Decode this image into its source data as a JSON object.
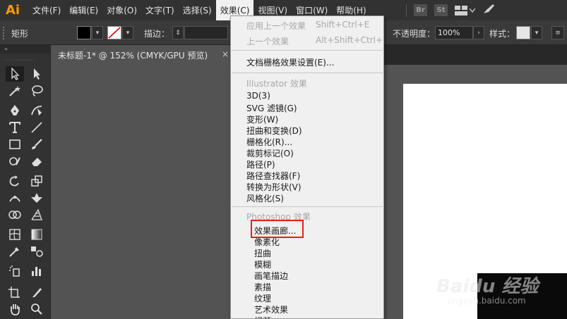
{
  "app": {
    "logo": "Ai"
  },
  "menubar": {
    "items": [
      "文件(F)",
      "编辑(E)",
      "对象(O)",
      "文字(T)",
      "选择(S)",
      "效果(C)",
      "视图(V)",
      "窗口(W)",
      "帮助(H)"
    ],
    "right_icons": [
      "Br",
      "St"
    ]
  },
  "controlbar": {
    "shape_label": "矩形",
    "stroke_label": "描边：",
    "opacity_label": "不透明度：",
    "opacity_value": "100%",
    "style_label": "样式："
  },
  "document": {
    "tab_title": "未标题-1* @ 152% (CMYK/GPU 预览)",
    "close_glyph": "×"
  },
  "effect_menu": {
    "items": [
      {
        "label": "应用上一个效果",
        "shortcut": "Shift+Ctrl+E",
        "disabled": true
      },
      {
        "label": "上一个效果",
        "shortcut": "Alt+Shift+Ctrl+E",
        "disabled": true
      },
      {
        "label": "文档栅格效果设置(E)...",
        "shortcut": "",
        "disabled": false
      },
      {
        "label": "Illustrator 效果",
        "shortcut": "",
        "disabled": true
      },
      {
        "label": "3D(3)",
        "shortcut": "",
        "disabled": false
      },
      {
        "label": "SVG 滤镜(G)",
        "shortcut": "",
        "disabled": false
      },
      {
        "label": "变形(W)",
        "shortcut": "",
        "disabled": false
      },
      {
        "label": "扭曲和变换(D)",
        "shortcut": "",
        "disabled": false
      },
      {
        "label": "栅格化(R)...",
        "shortcut": "",
        "disabled": false
      },
      {
        "label": "裁剪标记(O)",
        "shortcut": "",
        "disabled": false
      },
      {
        "label": "路径(P)",
        "shortcut": "",
        "disabled": false
      },
      {
        "label": "路径查找器(F)",
        "shortcut": "",
        "disabled": false
      },
      {
        "label": "转换为形状(V)",
        "shortcut": "",
        "disabled": false
      },
      {
        "label": "风格化(S)",
        "shortcut": "",
        "disabled": false
      },
      {
        "label": "Photoshop 效果",
        "shortcut": "",
        "disabled": true
      },
      {
        "label": "效果画廊...",
        "shortcut": "",
        "disabled": false
      },
      {
        "label": "像素化",
        "shortcut": "",
        "disabled": false
      },
      {
        "label": "扭曲",
        "shortcut": "",
        "disabled": false
      },
      {
        "label": "模糊",
        "shortcut": "",
        "disabled": false
      },
      {
        "label": "画笔描边",
        "shortcut": "",
        "disabled": false
      },
      {
        "label": "素描",
        "shortcut": "",
        "disabled": false
      },
      {
        "label": "纹理",
        "shortcut": "",
        "disabled": false
      },
      {
        "label": "艺术效果",
        "shortcut": "",
        "disabled": false
      },
      {
        "label": "视频",
        "shortcut": "",
        "disabled": false
      }
    ]
  },
  "watermark": {
    "main": "Baidu 经验",
    "sub": "jingyan.baidu.com"
  },
  "colors": {
    "accent": "#ff9a00",
    "highlight_border": "#e3201b",
    "menu_bg": "#f0f0f0",
    "ui_dark": "#323232"
  }
}
